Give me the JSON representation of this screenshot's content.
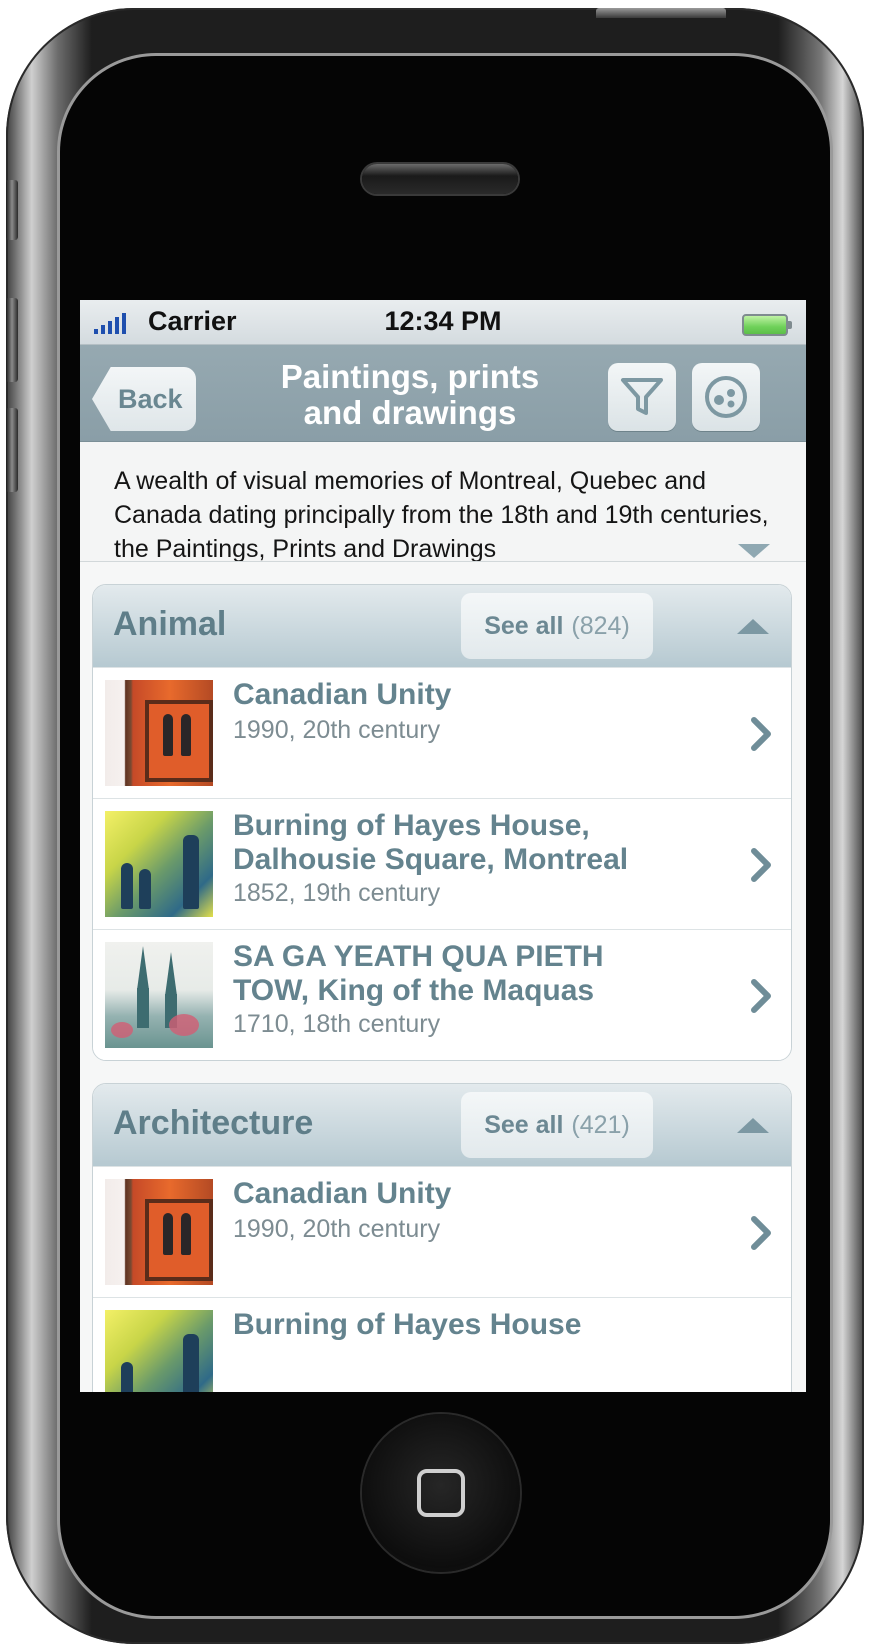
{
  "status_bar": {
    "carrier": "Carrier",
    "time": "12:34 PM"
  },
  "nav": {
    "back_label": "Back",
    "title_line1": "Paintings, prints",
    "title_line2": "and drawings",
    "filter_icon": "filter-icon",
    "options_icon": "options-icon"
  },
  "description": {
    "text": "A wealth of visual memories of Montreal, Quebec and Canada dating principally from the 18th and 19th centuries, the Paintings, Prints and Drawings"
  },
  "sections": [
    {
      "title": "Animal",
      "see_all_label": "See all",
      "count": "(824)",
      "items": [
        {
          "title": "Canadian Unity",
          "meta": "1990, 20th century"
        },
        {
          "title": "Burning of Hayes House, Dalhousie Square, Montreal",
          "meta": "1852, 19th century"
        },
        {
          "title": "SA GA YEATH QUA PIETH TOW, King of the Maquas",
          "meta": "1710, 18th century"
        }
      ]
    },
    {
      "title": "Architecture",
      "see_all_label": "See all",
      "count": "(421)",
      "items": [
        {
          "title": "Canadian Unity",
          "meta": "1990, 20th century"
        },
        {
          "title": "Burning of Hayes House",
          "meta": ""
        }
      ]
    }
  ],
  "colors": {
    "accent": "#64838e",
    "navbar": "#8a9ea7",
    "header_bg": "#b6c9d1"
  }
}
